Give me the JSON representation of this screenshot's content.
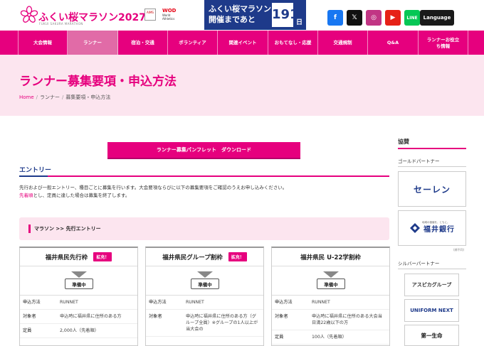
{
  "header": {
    "logo_title": "ふくい桜マラソン2027",
    "logo_sub": "FUKUI SAKURA MARATHON",
    "badge1": "AIMS",
    "badge2_top": "WOD",
    "badge2_sub": "World Athletics Label Road Races",
    "countdown_line1": "ふくい桜マラソン",
    "countdown_line2": "開催まであと",
    "countdown_days": "191",
    "countdown_unit": "日",
    "language": "Language",
    "social": [
      {
        "name": "facebook",
        "glyph": "f",
        "color": "#1877f2"
      },
      {
        "name": "x",
        "glyph": "𝕏",
        "color": "#111111"
      },
      {
        "name": "instagram",
        "glyph": "◎",
        "color": "#c13584"
      },
      {
        "name": "youtube",
        "glyph": "▶",
        "color": "#e62117"
      },
      {
        "name": "line",
        "glyph": "LINE",
        "color": "#06c755"
      }
    ]
  },
  "nav": [
    "大会情報",
    "ランナー",
    "宿泊・交通",
    "ボランティア",
    "関連イベント",
    "おもてなし・応援",
    "交通規制",
    "Q&A",
    "ランナーお役立ち情報"
  ],
  "hero": {
    "title": "ランナー募集要項・申込方法",
    "crumb_home": "Home",
    "crumb_runner": "ランナー",
    "crumb_current": "募集要項・申込方法"
  },
  "main": {
    "pamphlet_button": "ランナー募集パンフレット　ダウンロード",
    "entry_heading": "エントリー",
    "desc_line1": "先行および一般エントリー、種目ごとに募集を行います。大会要項ならびに以下の募集要項をご確認のうえお申し込みください。",
    "desc_highlight": "先着順",
    "desc_line2_rest": "とし、定員に達した場合は募集を終了します。",
    "sub_heading": "マラソン >> 先行エントリー",
    "cards": [
      {
        "title": "福井県民先行枠",
        "badge": "拡充！",
        "status": "準備中",
        "rows": [
          {
            "k": "申込方法",
            "v": "RUNNET"
          },
          {
            "k": "対象者",
            "v": "申込時に福井県に住所のある方"
          },
          {
            "k": "定員",
            "v": "2,000人（先着順）"
          }
        ]
      },
      {
        "title": "福井県民グループ割枠",
        "badge": "拡充！",
        "status": "準備中",
        "rows": [
          {
            "k": "申込方法",
            "v": "RUNNET"
          },
          {
            "k": "対象者",
            "v": "申込時に福井県に住所のある方（グループ全員）※グループの1人以上が当大会の"
          }
        ]
      },
      {
        "title": "福井県民 U-22学割枠",
        "badge": "",
        "status": "準備中",
        "rows": [
          {
            "k": "申込方法",
            "v": "RUNNET"
          },
          {
            "k": "対象者",
            "v": "申込時に福井県に住所のある大会当日満22歳以下の方"
          },
          {
            "k": "定員",
            "v": "100人（先着順）"
          }
        ]
      }
    ]
  },
  "sidebar": {
    "heading": "協賛",
    "gold_heading": "ゴールドパートナー",
    "gold": [
      "セーレン",
      "福井銀行"
    ],
    "bank_tagline": "地域の価値を、ともに。",
    "order_note": "(順不同)",
    "silver_heading": "シルバーパートナー",
    "silver": [
      "アスピカグループ",
      "UNIFORM NEXT",
      "第一生命"
    ]
  },
  "colors": {
    "brand": "#e6007e",
    "navy": "#1e3a8a",
    "hero_bg": "#fce5ef"
  }
}
